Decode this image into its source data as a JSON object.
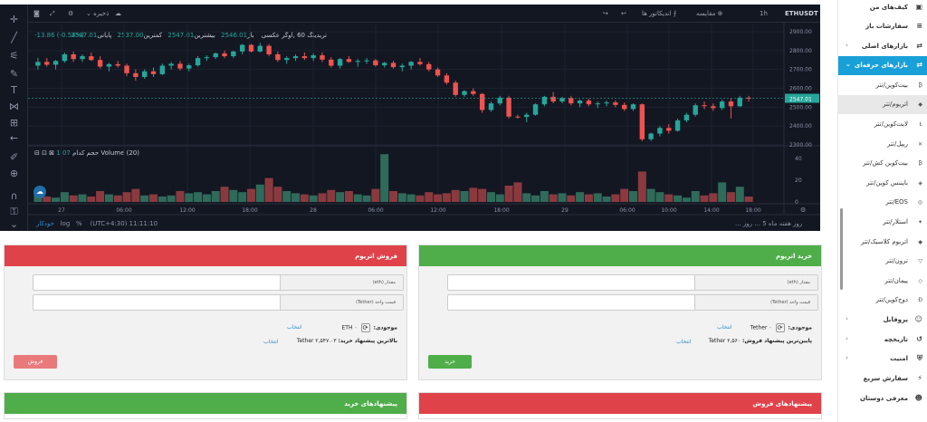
{
  "chart": {
    "symbol": "ETHUSDT",
    "interval": "1h",
    "toolbar": {
      "compare": "مقایسه",
      "indicators": "اندیکاتور ها",
      "save": "ذخیره"
    },
    "legend": {
      "label": "تریدینگ 60 ,آوگر عکسی",
      "open_label": "باز",
      "open": "2546.01",
      "high_label": "بیشترین",
      "high": "2547.01",
      "low_label": "کمترین",
      "low": "2537.00",
      "close_label": "پایانی",
      "close": "2547.01",
      "change": "-13.86 (-0.54%)"
    },
    "volume_legend": {
      "name": "Volume (20)",
      "value": "1.07",
      "suffix": "حجم کدام"
    },
    "bottom_bar": {
      "time": "(UTC+4:30) 11:11:10",
      "percent": "%",
      "log": "log",
      "auto": "خودکار",
      "ranges": [
        "روز",
        "هفته",
        "ماه",
        "5 ...",
        "روز ..."
      ]
    },
    "price_ticks": [
      "2900.00",
      "2800.00",
      "2700.00",
      "2600.00",
      "2500.00",
      "2400.00",
      "2300.00"
    ],
    "last_price": "2547.01",
    "vol_ticks": [
      "40",
      "20",
      "0"
    ],
    "time_labels": [
      {
        "t": "27",
        "x": 68
      },
      {
        "t": "06:00",
        "x": 137
      },
      {
        "t": "12:00",
        "x": 207
      },
      {
        "t": "18:00",
        "x": 276
      },
      {
        "t": "28",
        "x": 346
      },
      {
        "t": "06:00",
        "x": 415
      },
      {
        "t": "12:00",
        "x": 484
      },
      {
        "t": "18:00",
        "x": 554
      },
      {
        "t": "29",
        "x": 624
      },
      {
        "t": "06:00",
        "x": 693
      },
      {
        "t": "10:00",
        "x": 739
      },
      {
        "t": "14:00",
        "x": 786
      },
      {
        "t": "18:00",
        "x": 832
      }
    ]
  },
  "chart_data": {
    "type": "candlestick",
    "series": [
      {
        "name": "ETHUSDT",
        "ohlc": [
          [
            2720,
            2760,
            2700,
            2740
          ],
          [
            2740,
            2760,
            2715,
            2725
          ],
          [
            2725,
            2750,
            2700,
            2745
          ],
          [
            2745,
            2790,
            2735,
            2780
          ],
          [
            2780,
            2795,
            2740,
            2755
          ],
          [
            2755,
            2780,
            2740,
            2770
          ],
          [
            2770,
            2790,
            2745,
            2750
          ],
          [
            2750,
            2770,
            2705,
            2715
          ],
          [
            2715,
            2735,
            2690,
            2728
          ],
          [
            2728,
            2745,
            2710,
            2720
          ],
          [
            2720,
            2730,
            2665,
            2680
          ],
          [
            2680,
            2700,
            2640,
            2660
          ],
          [
            2660,
            2700,
            2650,
            2690
          ],
          [
            2690,
            2710,
            2660,
            2675
          ],
          [
            2675,
            2730,
            2670,
            2720
          ],
          [
            2720,
            2740,
            2700,
            2730
          ],
          [
            2730,
            2745,
            2695,
            2705
          ],
          [
            2705,
            2730,
            2690,
            2722
          ],
          [
            2722,
            2770,
            2715,
            2760
          ],
          [
            2760,
            2775,
            2745,
            2765
          ],
          [
            2765,
            2790,
            2755,
            2785
          ],
          [
            2785,
            2800,
            2760,
            2770
          ],
          [
            2770,
            2800,
            2760,
            2795
          ],
          [
            2795,
            2835,
            2780,
            2830
          ],
          [
            2830,
            2835,
            2790,
            2795
          ],
          [
            2795,
            2840,
            2790,
            2825
          ],
          [
            2825,
            2835,
            2770,
            2780
          ],
          [
            2780,
            2795,
            2740,
            2750
          ],
          [
            2750,
            2770,
            2730,
            2760
          ],
          [
            2760,
            2780,
            2745,
            2770
          ],
          [
            2770,
            2790,
            2750,
            2760
          ],
          [
            2760,
            2785,
            2745,
            2775
          ],
          [
            2775,
            2790,
            2740,
            2752
          ],
          [
            2752,
            2765,
            2710,
            2720
          ],
          [
            2720,
            2760,
            2705,
            2755
          ],
          [
            2755,
            2770,
            2735,
            2740
          ],
          [
            2740,
            2755,
            2715,
            2745
          ],
          [
            2745,
            2760,
            2730,
            2748
          ],
          [
            2748,
            2755,
            2715,
            2722
          ],
          [
            2722,
            2740,
            2710,
            2735
          ],
          [
            2735,
            2745,
            2705,
            2712
          ],
          [
            2712,
            2730,
            2690,
            2720
          ],
          [
            2720,
            2745,
            2700,
            2740
          ],
          [
            2740,
            2760,
            2720,
            2728
          ],
          [
            2728,
            2740,
            2690,
            2700
          ],
          [
            2700,
            2710,
            2660,
            2668
          ],
          [
            2668,
            2680,
            2620,
            2630
          ],
          [
            2630,
            2640,
            2555,
            2565
          ],
          [
            2565,
            2590,
            2555,
            2585
          ],
          [
            2585,
            2600,
            2560,
            2570
          ],
          [
            2570,
            2575,
            2470,
            2485
          ],
          [
            2485,
            2530,
            2475,
            2520
          ],
          [
            2520,
            2560,
            2510,
            2550
          ],
          [
            2550,
            2560,
            2440,
            2450
          ],
          [
            2450,
            2460,
            2440,
            2448
          ],
          [
            2448,
            2470,
            2420,
            2460
          ],
          [
            2460,
            2520,
            2455,
            2515
          ],
          [
            2515,
            2560,
            2505,
            2555
          ],
          [
            2555,
            2580,
            2520,
            2530
          ],
          [
            2530,
            2555,
            2520,
            2548
          ],
          [
            2548,
            2560,
            2510,
            2520
          ],
          [
            2520,
            2540,
            2500,
            2535
          ],
          [
            2535,
            2545,
            2505,
            2515
          ],
          [
            2515,
            2530,
            2495,
            2520
          ],
          [
            2520,
            2535,
            2505,
            2525
          ],
          [
            2525,
            2535,
            2500,
            2512
          ],
          [
            2512,
            2525,
            2480,
            2490
          ],
          [
            2490,
            2520,
            2480,
            2515
          ],
          [
            2515,
            2520,
            2320,
            2330
          ],
          [
            2330,
            2365,
            2320,
            2360
          ],
          [
            2360,
            2400,
            2345,
            2390
          ],
          [
            2390,
            2410,
            2360,
            2375
          ],
          [
            2375,
            2440,
            2370,
            2430
          ],
          [
            2430,
            2470,
            2420,
            2460
          ],
          [
            2460,
            2520,
            2450,
            2510
          ],
          [
            2510,
            2530,
            2490,
            2505
          ],
          [
            2505,
            2520,
            2480,
            2495
          ],
          [
            2495,
            2540,
            2485,
            2530
          ],
          [
            2530,
            2545,
            2440,
            2505
          ],
          [
            2505,
            2560,
            2500,
            2550
          ],
          [
            2550,
            2560,
            2530,
            2547
          ]
        ]
      },
      {
        "name": "Volume",
        "values": [
          8,
          5,
          4,
          9,
          6,
          7,
          5,
          10,
          7,
          6,
          9,
          12,
          6,
          7,
          5,
          6,
          10,
          8,
          9,
          7,
          10,
          14,
          11,
          9,
          12,
          16,
          22,
          14,
          10,
          8,
          7,
          6,
          8,
          11,
          9,
          10,
          7,
          6,
          12,
          44,
          10,
          8,
          7,
          6,
          9,
          7,
          8,
          11,
          10,
          13,
          12,
          9,
          7,
          15,
          18,
          8,
          6,
          10,
          7,
          8,
          6,
          9,
          7,
          8,
          5,
          7,
          12,
          10,
          28,
          12,
          9,
          7,
          6,
          4,
          10,
          6,
          8,
          18,
          9,
          14,
          5
        ]
      }
    ],
    "ylim": [
      2300,
      2900
    ]
  },
  "sell_panel": {
    "title": "فروش اتریوم",
    "amount_label": "مقدار (eth)",
    "price_label": "قیمت واحد (Tether)",
    "balance_label": "موجودی:",
    "balance_currency": "ETH",
    "balance_value": "۰",
    "select_link": "انتخاب",
    "best_offer_label": "بالاترین پیشنهاد خرید:",
    "best_offer_value": "Tether ۲,۵۴۷.۰۳",
    "button": "فروش"
  },
  "buy_panel": {
    "title": "خرید اتریوم",
    "amount_label": "مقدار (eth)",
    "price_label": "قیمت واحد (Tether)",
    "balance_label": "موجودی:",
    "balance_currency": "Tether",
    "balance_value": "۰",
    "select_link": "انتخاب",
    "best_offer_label": "پایین‌ترین پیشنهاد فروش:",
    "best_offer_value": "Tether ۲,۵۶۰",
    "button": "خرید"
  },
  "buy_offers_panel": {
    "title": "پیشنهادهای خرید"
  },
  "sell_offers_panel": {
    "title": "پیشنهادهای فروش"
  },
  "sidebar": {
    "items": [
      {
        "label": "کیف‌های من",
        "icon": "wallet-icon",
        "glyph": "▣",
        "type": "main"
      },
      {
        "label": "سفارشات باز",
        "icon": "list-icon",
        "glyph": "≡",
        "type": "main"
      },
      {
        "label": "بازارهای اصلی",
        "icon": "market-icon",
        "glyph": "⇄",
        "type": "main",
        "chev": "‹"
      },
      {
        "label": "بازارهای حرفه‌ای",
        "icon": "pro-market-icon",
        "glyph": "⇄",
        "type": "active",
        "chev": "⌄"
      },
      {
        "label": "بیت‌کوین/تتر",
        "icon": "bitcoin-icon",
        "glyph": "₿",
        "type": "sub"
      },
      {
        "label": "اتریوم/تتر",
        "icon": "ethereum-icon",
        "glyph": "◆",
        "type": "selected"
      },
      {
        "label": "لایت‌کوین/تتر",
        "icon": "litecoin-icon",
        "glyph": "Ł",
        "type": "sub"
      },
      {
        "label": "ریپل/تتر",
        "icon": "ripple-icon",
        "glyph": "✕",
        "type": "sub"
      },
      {
        "label": "بیت‌کوین کش/تتر",
        "icon": "bitcoin-cash-icon",
        "glyph": "₿",
        "type": "sub"
      },
      {
        "label": "بایننس کوین/تتر",
        "icon": "binance-icon",
        "glyph": "◈",
        "type": "sub"
      },
      {
        "label": "EOS/تتر",
        "icon": "eos-icon",
        "glyph": "◎",
        "type": "sub"
      },
      {
        "label": "استلار/تتر",
        "icon": "stellar-icon",
        "glyph": "✦",
        "type": "sub"
      },
      {
        "label": "اتریوم کلاسیک/تتر",
        "icon": "ethereum-classic-icon",
        "glyph": "◆",
        "type": "sub"
      },
      {
        "label": "ترون/تتر",
        "icon": "tron-icon",
        "glyph": "▽",
        "type": "sub"
      },
      {
        "label": "پیمان/تتر",
        "icon": "paymon-icon",
        "glyph": "◇",
        "type": "sub"
      },
      {
        "label": "دوج‌کوین/تتر",
        "icon": "dogecoin-icon",
        "glyph": "Ð",
        "type": "sub"
      },
      {
        "label": "پروفایل",
        "icon": "user-icon",
        "glyph": "☺",
        "type": "main",
        "chev": "‹"
      },
      {
        "label": "تاریخچه",
        "icon": "history-icon",
        "glyph": "↺",
        "type": "main",
        "chev": "‹"
      },
      {
        "label": "امنیت",
        "icon": "shield-icon",
        "glyph": "⛨",
        "type": "main",
        "chev": "‹"
      },
      {
        "label": "سفارش سریع",
        "icon": "bolt-icon",
        "glyph": "⚡",
        "type": "main"
      },
      {
        "label": "معرفی دوستان",
        "icon": "friends-icon",
        "glyph": "☻",
        "type": "main"
      }
    ]
  }
}
